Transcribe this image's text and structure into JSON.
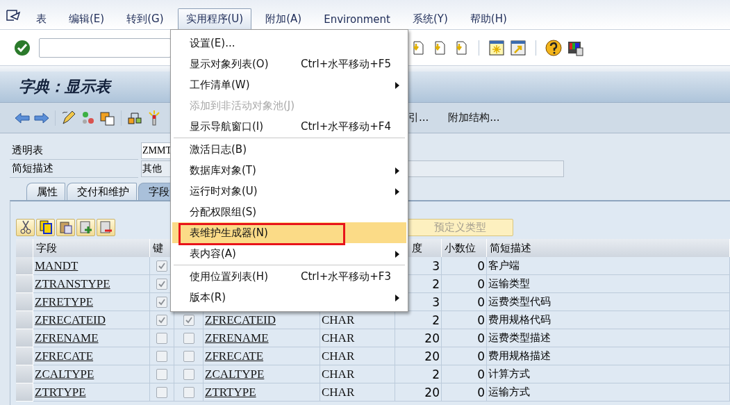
{
  "menubar": {
    "items": [
      {
        "label": "表",
        "selected": false
      },
      {
        "label": "编辑(E)",
        "selected": false
      },
      {
        "label": "转到(G)",
        "selected": false
      },
      {
        "label": "实用程序(U)",
        "selected": true
      },
      {
        "label": "附加(A)",
        "selected": false
      },
      {
        "label": "Environment",
        "selected": false
      },
      {
        "label": "系统(Y)",
        "selected": false
      },
      {
        "label": "帮助(H)",
        "selected": false
      }
    ]
  },
  "title": "字典：显示表",
  "app_toolbar": {
    "buttons": [
      "引...",
      "附加结构..."
    ]
  },
  "fields": [
    {
      "label": "透明表",
      "value": "ZMMT"
    },
    {
      "label": "简短描述",
      "value": "其他"
    }
  ],
  "tabs": [
    {
      "label": "属性",
      "selected": false
    },
    {
      "label": "交付和维护",
      "selected": false
    },
    {
      "label": "字段",
      "selected": true
    }
  ],
  "table_toolbar": {
    "button": "预定义类型"
  },
  "table": {
    "header": {
      "field": "字段",
      "key": "键",
      "length": "度",
      "decimals": "小数位",
      "description": "简短描述"
    },
    "rows": [
      {
        "field": "MANDT",
        "key": true,
        "length": "3",
        "decimals": "0",
        "description": "客户端"
      },
      {
        "field": "ZTRANSTYPE",
        "key": true,
        "length": "2",
        "decimals": "0",
        "description": "运输类型"
      },
      {
        "field": "ZFRETYPE",
        "key": true,
        "length": "3",
        "decimals": "0",
        "description": "运费类型代码"
      },
      {
        "field": "ZFRECATEID",
        "key": true,
        "initial": true,
        "data_element": "ZFRECATEID",
        "data_type": "CHAR",
        "length": "2",
        "decimals": "0",
        "description": "费用规格代码"
      },
      {
        "field": "ZFRENAME",
        "key": false,
        "initial": false,
        "data_element": "ZFRENAME",
        "data_type": "CHAR",
        "length": "20",
        "decimals": "0",
        "description": "运费类型描述"
      },
      {
        "field": "ZFRECATE",
        "key": false,
        "initial": false,
        "data_element": "ZFRECATE",
        "data_type": "CHAR",
        "length": "20",
        "decimals": "0",
        "description": "费用规格描述"
      },
      {
        "field": "ZCALTYPE",
        "key": false,
        "initial": false,
        "data_element": "ZCALTYPE",
        "data_type": "CHAR",
        "length": "2",
        "decimals": "0",
        "description": "计算方式"
      },
      {
        "field": "ZTRTYPE",
        "key": false,
        "initial": false,
        "data_element": "ZTRTYPE",
        "data_type": "CHAR",
        "length": "20",
        "decimals": "0",
        "description": "运输方式"
      }
    ]
  },
  "menu": {
    "items": [
      {
        "kind": "item",
        "label": "设置(E)...",
        "submenu": false,
        "disabled": false,
        "selected": false
      },
      {
        "kind": "item",
        "label": "显示对象列表(O)",
        "shortcut": "Ctrl+水平移动+F5",
        "submenu": false,
        "disabled": false,
        "selected": false
      },
      {
        "kind": "item",
        "label": "工作清单(W)",
        "submenu": true,
        "disabled": false,
        "selected": false
      },
      {
        "kind": "item",
        "label": "添加到非活动对象池(J)",
        "submenu": false,
        "disabled": true,
        "selected": false
      },
      {
        "kind": "item",
        "label": "显示导航窗口(I)",
        "shortcut": "Ctrl+水平移动+F4",
        "submenu": false,
        "disabled": false,
        "selected": false
      },
      {
        "kind": "separator"
      },
      {
        "kind": "item",
        "label": "激活日志(B)",
        "submenu": false,
        "disabled": false,
        "selected": false
      },
      {
        "kind": "item",
        "label": "数据库对象(T)",
        "submenu": true,
        "disabled": false,
        "selected": false
      },
      {
        "kind": "item",
        "label": "运行时对象(U)",
        "submenu": true,
        "disabled": false,
        "selected": false
      },
      {
        "kind": "item",
        "label": "分配权限组(S)",
        "submenu": false,
        "disabled": false,
        "selected": false
      },
      {
        "kind": "item",
        "label": "表维护生成器(N)",
        "submenu": false,
        "disabled": false,
        "selected": true
      },
      {
        "kind": "item",
        "label": "表内容(A)",
        "submenu": true,
        "disabled": false,
        "selected": false
      },
      {
        "kind": "separator"
      },
      {
        "kind": "item",
        "label": "使用位置列表(H)",
        "shortcut": "Ctrl+水平移动+F3",
        "submenu": false,
        "disabled": false,
        "selected": false
      },
      {
        "kind": "item",
        "label": "版本(R)",
        "submenu": true,
        "disabled": false,
        "selected": false
      }
    ]
  }
}
